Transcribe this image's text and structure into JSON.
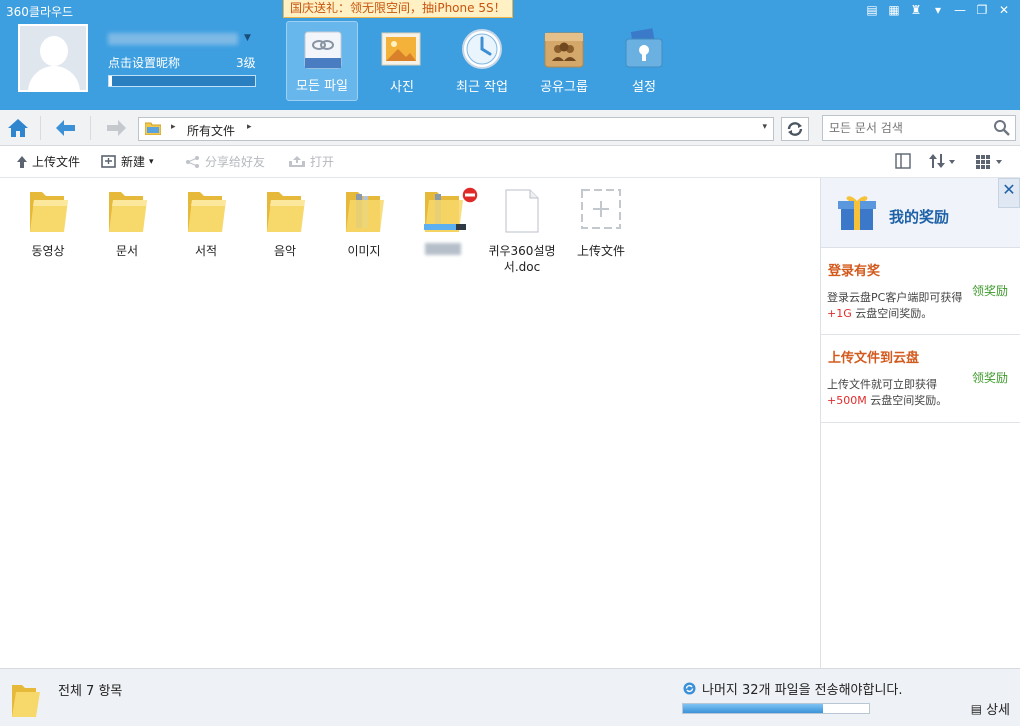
{
  "app": {
    "title": "360클라우드"
  },
  "promo": {
    "text": "国庆送礼：领无限空间，抽iPhone 5S！"
  },
  "user": {
    "nickname_prompt": "点击设置昵称",
    "level": "3级",
    "level_progress": 0.02
  },
  "nav": [
    {
      "label": "모든 파일",
      "icon": "all-files-icon",
      "active": true
    },
    {
      "label": "사진",
      "icon": "photos-icon",
      "active": false
    },
    {
      "label": "최근 작업",
      "icon": "clock-icon",
      "active": false
    },
    {
      "label": "공유그룹",
      "icon": "share-group-icon",
      "active": false
    },
    {
      "label": "설정",
      "icon": "settings-icon",
      "active": false
    }
  ],
  "window_controls": [
    "note-icon",
    "grid-icon",
    "shirt-icon",
    "menu-icon",
    "minimize-icon",
    "restore-icon",
    "close-icon"
  ],
  "address": {
    "breadcrumb": "所有文件"
  },
  "search": {
    "placeholder": "모든 문서 검색"
  },
  "toolbar": {
    "upload": "上传文件",
    "new": "新建",
    "share": "分享给好友",
    "open": "打开"
  },
  "files": [
    {
      "name": "동영상",
      "type": "folder"
    },
    {
      "name": "문서",
      "type": "folder"
    },
    {
      "name": "서적",
      "type": "folder"
    },
    {
      "name": "음악",
      "type": "folder"
    },
    {
      "name": "이미지",
      "type": "folder-docs"
    },
    {
      "name": "",
      "type": "folder-uploading",
      "progress": 0.75
    },
    {
      "name": "퀴우360설명서.doc",
      "type": "doc"
    },
    {
      "name": "上传文件",
      "type": "upload"
    }
  ],
  "panel": {
    "title": "我的奖励",
    "rewards": [
      {
        "title": "登录有奖",
        "claim": "领奖励",
        "desc_pre": "登录云盘PC客户端即可获得 ",
        "highlight": "+1G",
        "desc_post": " 云盘空间奖励。"
      },
      {
        "title": "上传文件到云盘",
        "claim": "领奖励",
        "desc_pre": "上传文件就可立即获得 ",
        "highlight": "+500M",
        "desc_post": " 云盘空间奖励。"
      }
    ]
  },
  "status": {
    "count": "전체 7 항목",
    "sync_text": "나머지 32개 파일을 전송해야합니다.",
    "sync_progress": 0.75,
    "detail": "상세"
  },
  "colors": {
    "header": "#3d9fe0",
    "accent": "#1f62a8",
    "reward_title": "#d35a1d",
    "claim": "#3c9a2a"
  }
}
